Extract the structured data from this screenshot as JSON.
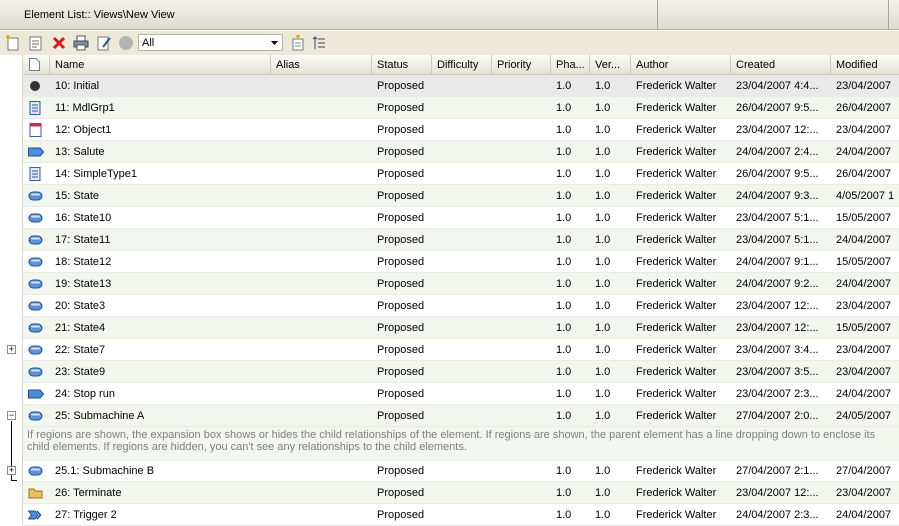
{
  "window": {
    "title": "Element List:: Views\\New View"
  },
  "toolbar": {
    "filter_value": "All",
    "icons": [
      "new-element-icon",
      "properties-icon",
      "delete-icon",
      "print-icon",
      "edit-note-icon",
      "circle-icon",
      "filter-settings-icon",
      "toggle-notes-icon"
    ]
  },
  "table": {
    "columns": [
      "Name",
      "Alias",
      "Status",
      "Difficulty",
      "Priority",
      "Pha...",
      "Ver...",
      "Author",
      "Created",
      "Modified"
    ],
    "rows": [
      {
        "icon": "initial",
        "name": "10: Initial",
        "alias": "",
        "status": "Proposed",
        "difficulty": "",
        "priority": "",
        "phase": "1.0",
        "version": "1.0",
        "author": "Frederick Walter",
        "created": "23/04/2007 4:4...",
        "modified": "23/04/2007"
      },
      {
        "icon": "doc",
        "name": "11: MdlGrp1",
        "alias": "",
        "status": "Proposed",
        "difficulty": "",
        "priority": "",
        "phase": "1.0",
        "version": "1.0",
        "author": "Frederick Walter",
        "created": "26/04/2007 9:5...",
        "modified": "26/04/2007"
      },
      {
        "icon": "object",
        "name": "12: Object1",
        "alias": "",
        "status": "Proposed",
        "difficulty": "",
        "priority": "",
        "phase": "1.0",
        "version": "1.0",
        "author": "Frederick Walter",
        "created": "23/04/2007 12:...",
        "modified": "23/04/2007"
      },
      {
        "icon": "signal",
        "name": "13: Salute",
        "alias": "",
        "status": "Proposed",
        "difficulty": "",
        "priority": "",
        "phase": "1.0",
        "version": "1.0",
        "author": "Frederick Walter",
        "created": "24/04/2007 2:4...",
        "modified": "24/04/2007"
      },
      {
        "icon": "doc",
        "name": "14: SimpleType1",
        "alias": "",
        "status": "Proposed",
        "difficulty": "",
        "priority": "",
        "phase": "1.0",
        "version": "1.0",
        "author": "Frederick Walter",
        "created": "26/04/2007 9:5...",
        "modified": "26/04/2007"
      },
      {
        "icon": "state",
        "name": "15: State",
        "alias": "",
        "status": "Proposed",
        "difficulty": "",
        "priority": "",
        "phase": "1.0",
        "version": "1.0",
        "author": "Frederick Walter",
        "created": "24/04/2007 9:3...",
        "modified": "4/05/2007 1"
      },
      {
        "icon": "state",
        "name": "16: State10",
        "alias": "",
        "status": "Proposed",
        "difficulty": "",
        "priority": "",
        "phase": "1.0",
        "version": "1.0",
        "author": "Frederick Walter",
        "created": "23/04/2007 5:1...",
        "modified": "15/05/2007"
      },
      {
        "icon": "state",
        "name": "17: State11",
        "alias": "",
        "status": "Proposed",
        "difficulty": "",
        "priority": "",
        "phase": "1.0",
        "version": "1.0",
        "author": "Frederick Walter",
        "created": "23/04/2007 5:1...",
        "modified": "24/04/2007"
      },
      {
        "icon": "state",
        "name": "18: State12",
        "alias": "",
        "status": "Proposed",
        "difficulty": "",
        "priority": "",
        "phase": "1.0",
        "version": "1.0",
        "author": "Frederick Walter",
        "created": "24/04/2007 9:1...",
        "modified": "15/05/2007"
      },
      {
        "icon": "state",
        "name": "19: State13",
        "alias": "",
        "status": "Proposed",
        "difficulty": "",
        "priority": "",
        "phase": "1.0",
        "version": "1.0",
        "author": "Frederick Walter",
        "created": "24/04/2007 9:2...",
        "modified": "24/04/2007"
      },
      {
        "icon": "state",
        "name": "20: State3",
        "alias": "",
        "status": "Proposed",
        "difficulty": "",
        "priority": "",
        "phase": "1.0",
        "version": "1.0",
        "author": "Frederick Walter",
        "created": "23/04/2007 12:...",
        "modified": "23/04/2007"
      },
      {
        "icon": "state",
        "name": "21: State4",
        "alias": "",
        "status": "Proposed",
        "difficulty": "",
        "priority": "",
        "phase": "1.0",
        "version": "1.0",
        "author": "Frederick Walter",
        "created": "23/04/2007 12:...",
        "modified": "15/05/2007"
      },
      {
        "icon": "state",
        "name": "22: State7",
        "alias": "",
        "status": "Proposed",
        "difficulty": "",
        "priority": "",
        "phase": "1.0",
        "version": "1.0",
        "author": "Frederick Walter",
        "created": "23/04/2007 3:4...",
        "modified": "23/04/2007"
      },
      {
        "icon": "state",
        "name": "23: State9",
        "alias": "",
        "status": "Proposed",
        "difficulty": "",
        "priority": "",
        "phase": "1.0",
        "version": "1.0",
        "author": "Frederick Walter",
        "created": "23/04/2007 3:5...",
        "modified": "23/04/2007"
      },
      {
        "icon": "signal",
        "name": "24: Stop run",
        "alias": "",
        "status": "Proposed",
        "difficulty": "",
        "priority": "",
        "phase": "1.0",
        "version": "1.0",
        "author": "Frederick Walter",
        "created": "23/04/2007 2:3...",
        "modified": "24/04/2007"
      },
      {
        "icon": "state",
        "name": "25: Submachine A",
        "alias": "",
        "status": "Proposed",
        "difficulty": "",
        "priority": "",
        "phase": "1.0",
        "version": "1.0",
        "author": "Frederick Walter",
        "created": "27/04/2007 2:0...",
        "modified": "24/05/2007"
      },
      {
        "icon": "state",
        "name": "25.1: Submachine B",
        "alias": "",
        "status": "Proposed",
        "difficulty": "",
        "priority": "",
        "phase": "1.0",
        "version": "1.0",
        "author": "Frederick Walter",
        "created": "27/04/2007 2:1...",
        "modified": "27/04/2007"
      },
      {
        "icon": "folder",
        "name": "26: Terminate",
        "alias": "",
        "status": "Proposed",
        "difficulty": "",
        "priority": "",
        "phase": "1.0",
        "version": "1.0",
        "author": "Frederick Walter",
        "created": "23/04/2007 12:...",
        "modified": "23/04/2007"
      },
      {
        "icon": "trigger",
        "name": "27: Trigger 2",
        "alias": "",
        "status": "Proposed",
        "difficulty": "",
        "priority": "",
        "phase": "1.0",
        "version": "1.0",
        "author": "Frederick Walter",
        "created": "24/04/2007 2:3...",
        "modified": "24/04/2007"
      }
    ]
  },
  "note_text": "If regions are shown, the expansion box shows or hides the child relationships of the element. If regions are shown, the parent element has a line dropping down to enclose its child elements. If regions are hidden, you can't see any relationships to the child elements.",
  "expanders": {
    "collapsed": "+",
    "expanded": "−"
  }
}
